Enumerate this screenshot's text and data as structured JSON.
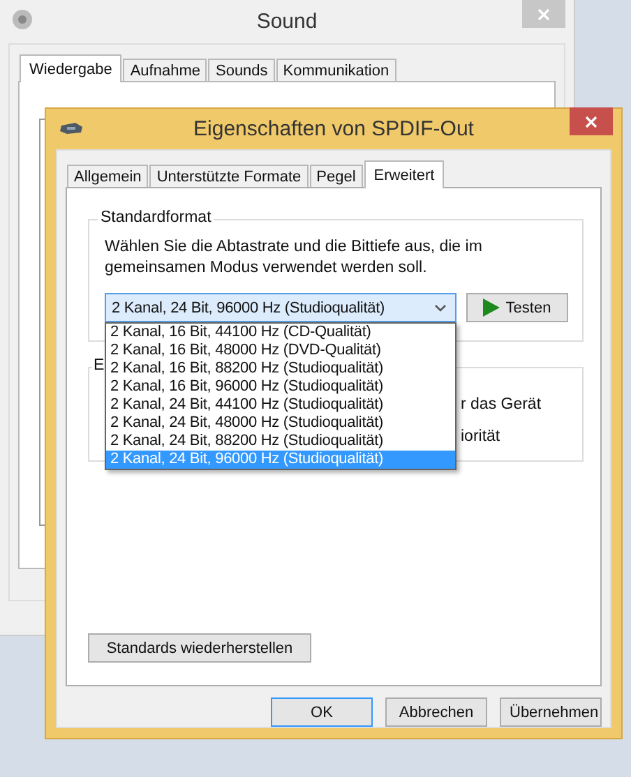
{
  "background_window": {
    "title": "Sound",
    "tabs": [
      {
        "label": "Wiedergabe",
        "selected": true
      },
      {
        "label": "Aufnahme",
        "selected": false
      },
      {
        "label": "Sounds",
        "selected": false
      },
      {
        "label": "Kommunikation",
        "selected": false
      }
    ]
  },
  "dialog": {
    "title": "Eigenschaften von SPDIF-Out",
    "tabs": [
      {
        "label": "Allgemein",
        "selected": false
      },
      {
        "label": "Unterstützte Formate",
        "selected": false
      },
      {
        "label": "Pegel",
        "selected": false
      },
      {
        "label": "Erweitert",
        "selected": true
      }
    ],
    "default_format": {
      "heading": "Standardformat",
      "description": "Wählen Sie die Abtastrate und die Bittiefe aus, die im gemeinsamen Modus verwendet werden soll.",
      "dropdown": {
        "value": "2 Kanal, 24 Bit, 96000 Hz (Studioqualität)",
        "expanded": true,
        "options": [
          {
            "label": "2 Kanal, 16 Bit, 44100 Hz (CD-Qualität)",
            "selected": false
          },
          {
            "label": "2 Kanal, 16 Bit, 48000 Hz (DVD-Qualität)",
            "selected": false
          },
          {
            "label": "2 Kanal, 16 Bit, 88200 Hz (Studioqualität)",
            "selected": false
          },
          {
            "label": "2 Kanal, 16 Bit, 96000 Hz (Studioqualität)",
            "selected": false
          },
          {
            "label": "2 Kanal, 24 Bit, 44100 Hz (Studioqualität)",
            "selected": false
          },
          {
            "label": "2 Kanal, 24 Bit, 48000 Hz (Studioqualität)",
            "selected": false
          },
          {
            "label": "2 Kanal, 24 Bit, 88200 Hz (Studioqualität)",
            "selected": false
          },
          {
            "label": "2 Kanal, 24 Bit, 96000 Hz (Studioqualität)",
            "selected": true
          }
        ]
      },
      "test_button": "Testen"
    },
    "second_group": {
      "heading": "E",
      "fragments": [
        "r das Gerät",
        "iorität"
      ]
    },
    "restore_button": "Standards wiederherstellen",
    "buttons": [
      {
        "label": "OK",
        "default": true
      },
      {
        "label": "Abbrechen",
        "default": false
      },
      {
        "label": "Übernehmen",
        "default": false
      }
    ]
  }
}
